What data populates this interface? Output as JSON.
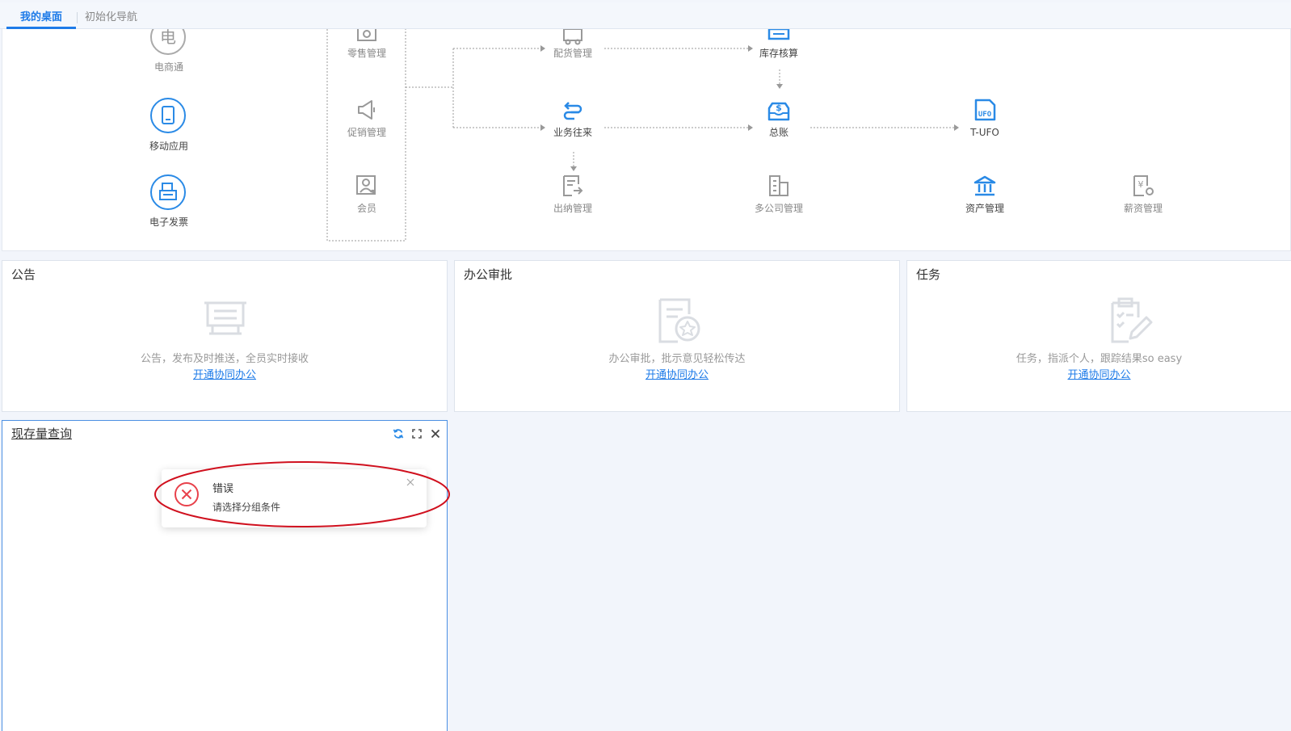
{
  "tabs": [
    {
      "label": "我的桌面",
      "active": true
    },
    {
      "label": "初始化导航",
      "active": false
    }
  ],
  "colors": {
    "accent": "#1e7be8",
    "error": "#e8414b",
    "annotation": "#d0101e"
  },
  "nav": {
    "left_apps": [
      {
        "label": "电商通",
        "icon": "ecommerce-icon",
        "glyph": "电"
      },
      {
        "label": "移动应用",
        "icon": "mobile-app-icon"
      },
      {
        "label": "电子发票",
        "icon": "e-invoice-icon"
      }
    ],
    "modules": {
      "retail": "零售管理",
      "promotion": "促销管理",
      "member": "会员",
      "distribution": "配货管理",
      "inventory_accounting": "库存核算",
      "business_contacts": "业务往来",
      "general_ledger": "总账",
      "tufo": "T-UFO",
      "cashier": "出纳管理",
      "multi_company": "多公司管理",
      "assets": "资产管理",
      "payroll": "薪资管理"
    }
  },
  "cards": {
    "announcement": {
      "title": "公告",
      "desc": "公告，发布及时推送，全员实时接收",
      "link": "开通协同办公"
    },
    "approval": {
      "title": "办公审批",
      "desc": "办公审批，批示意见轻松传达",
      "link": "开通协同办公"
    },
    "tasks": {
      "title": "任务",
      "desc": "任务，指派个人，跟踪结果so easy",
      "link": "开通协同办公"
    }
  },
  "widget": {
    "title": "现存量查询"
  },
  "toast": {
    "title": "错误",
    "message": "请选择分组条件"
  }
}
